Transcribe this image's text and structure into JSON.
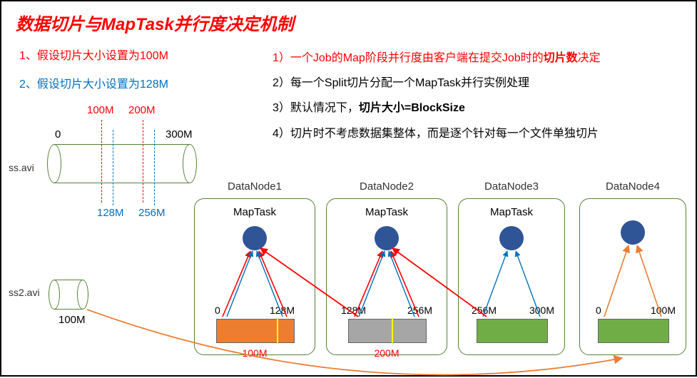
{
  "title": "数据切片与MapTask并行度决定机制",
  "assumptions": {
    "a1": "1、假设切片大小设置为100M",
    "a2": "2、假设切片大小设置为128M"
  },
  "rules": {
    "r1": "1）一个Job的Map阶段并行度由客户端在提交Job时的",
    "r1_bold": "切片数",
    "r1_tail": "决定",
    "r2": "2）每一个Split切片分配一个MapTask并行实例处理",
    "r3_head": "3）默认情况下，",
    "r3_bold": "切片大小=BlockSize",
    "r4": "4）切片时不考虑数据集整体，而是逐个针对每一个文件单独切片"
  },
  "cylinder": {
    "zero": "0",
    "end": "300M",
    "m100": "100M",
    "m200": "200M",
    "m128": "128M",
    "m256": "256M",
    "file1": "ss.avi",
    "file2": "ss2.avi",
    "file2_size": "100M"
  },
  "nodes": {
    "dn1": {
      "title": "DataNode1",
      "task": "MapTask",
      "left": "0",
      "right": "128M",
      "bottom": "100M"
    },
    "dn2": {
      "title": "DataNode2",
      "task": "MapTask",
      "left": "128M",
      "right": "256M",
      "bottom": "200M"
    },
    "dn3": {
      "title": "DataNode3",
      "task": "MapTask",
      "left": "256M",
      "right": "300M"
    },
    "dn4": {
      "title": "DataNode4",
      "left": "0",
      "right": "100M"
    }
  },
  "chart_data": {
    "type": "diagram",
    "title": "数据切片与MapTask并行度决定机制",
    "files": [
      {
        "name": "ss.avi",
        "size_mb": 300
      },
      {
        "name": "ss2.avi",
        "size_mb": 100
      }
    ],
    "split_plans": [
      {
        "split_size_mb": 100,
        "boundaries_mb": [
          0,
          100,
          200,
          300
        ]
      },
      {
        "split_size_mb": 128,
        "boundaries_mb": [
          0,
          128,
          256,
          300
        ]
      }
    ],
    "datanodes": [
      {
        "name": "DataNode1",
        "has_maptask": true,
        "block_range_mb": [
          0,
          128
        ],
        "split_marker_mb": 100,
        "block_color": "orange"
      },
      {
        "name": "DataNode2",
        "has_maptask": true,
        "block_range_mb": [
          128,
          256
        ],
        "split_marker_mb": 200,
        "block_color": "gray"
      },
      {
        "name": "DataNode3",
        "has_maptask": true,
        "block_range_mb": [
          256,
          300
        ],
        "block_color": "green"
      },
      {
        "name": "DataNode4",
        "has_maptask": false,
        "block_range_mb": [
          0,
          100
        ],
        "block_color": "green",
        "file": "ss2.avi"
      }
    ],
    "cross_node_reads": [
      {
        "from_node": "DataNode2",
        "to_maptask_node": "DataNode1"
      },
      {
        "from_node": "DataNode3",
        "to_maptask_node": "DataNode2"
      }
    ]
  }
}
